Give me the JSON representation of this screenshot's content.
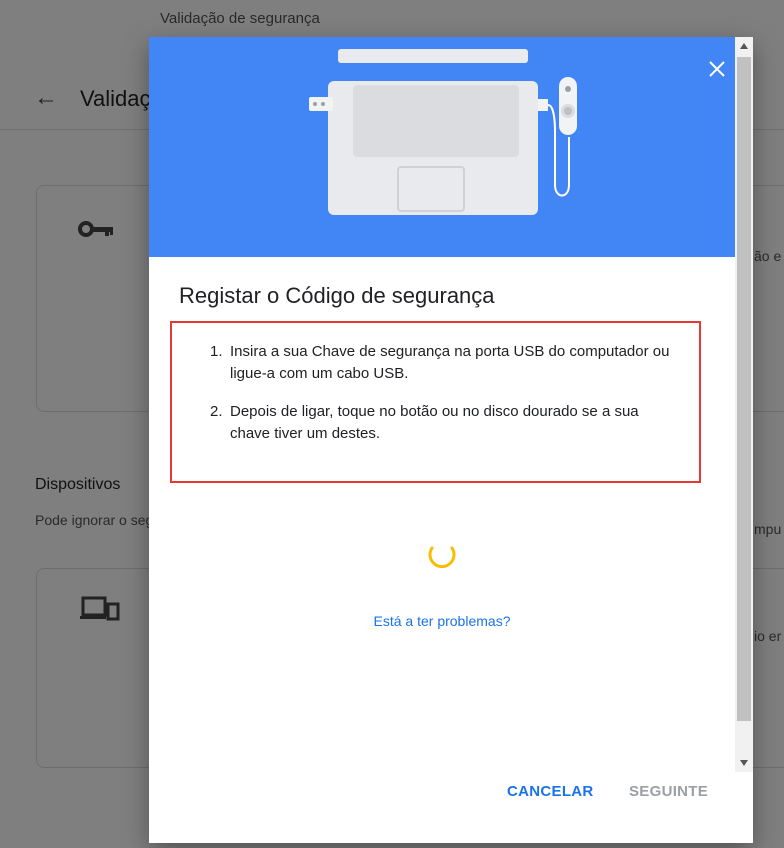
{
  "background": {
    "breadcrumb": "Validação de segurança",
    "back_icon": "arrow-left-icon",
    "page_title": "Validação em dois passos",
    "section_title": "Dispositivos",
    "section_subtitle": "Pode ignorar o segundo passo em computadores",
    "right_text_1": "ão e",
    "right_text_2": "mpu",
    "right_text_3": "io er"
  },
  "dialog": {
    "close_icon": "close-icon",
    "title": "Registar o Código de segurança",
    "steps": [
      {
        "num": "1.",
        "text": "Insira a sua Chave de segurança na porta USB do computador ou ligue-a com um cabo USB."
      },
      {
        "num": "2.",
        "text": "Depois de ligar, toque no botão ou no disco dourado se a sua chave tiver um destes."
      }
    ],
    "help_link": "Está a ter problemas?",
    "cancel_label": "CANCELAR",
    "next_label": "SEGUINTE"
  },
  "colors": {
    "hero": "#4285f4",
    "accent": "#1a73e8",
    "spinner": "#fbbc04",
    "highlight": "#e53935"
  }
}
